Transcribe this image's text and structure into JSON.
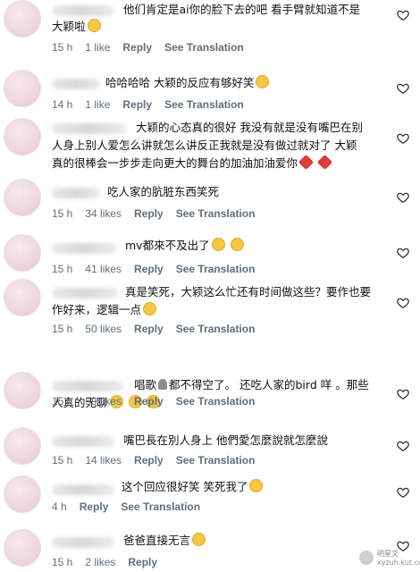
{
  "comments": [
    {
      "text_lines": [
        "他们肯定是ai你的脸下去的吧 看手臂就知道不是",
        "大颖啦"
      ],
      "emoji_tail": "😂",
      "time": "15 h",
      "likes": "1 like",
      "reply": "Reply",
      "translate": "See Translation"
    },
    {
      "text_lines": [
        "哈哈哈哈 大颖的反应有够好笑"
      ],
      "emoji_tail": "😂",
      "time": "14 h",
      "likes": "1 like",
      "reply": "Reply",
      "translate": "See Translation"
    },
    {
      "text_lines": [
        "大颖的心态真的很好 我没有就是没有嘴巴在别",
        "人身上别人爱怎么讲就怎么讲反正我就是没有做过就对了 大颖",
        "真的很棒会一步步走向更大的舞台的加油加油爱你"
      ],
      "emoji_tail": "❤️ ❤️",
      "time": "",
      "likes": "",
      "reply": "",
      "translate": ""
    },
    {
      "text_lines": [
        "吃人家的肮脏东西笑死"
      ],
      "emoji_tail": "",
      "time": "15 h",
      "likes": "34 likes",
      "reply": "Reply",
      "translate": "See Translation"
    },
    {
      "text_lines": [
        "mv都來不及出了"
      ],
      "emoji_tail": "😰 🤣",
      "time": "15 h",
      "likes": "41 likes",
      "reply": "Reply",
      "translate": "See Translation"
    },
    {
      "text_lines": [
        "真是笑死，大颖这么忙还有时间做这些？要作也要",
        "作好来，逻辑一点"
      ],
      "emoji_tail": "😂",
      "time": "15 h",
      "likes": "50 likes",
      "reply": "Reply",
      "translate": "See Translation"
    },
    {
      "text_lines": [
        "唱歌",
        "都不得空了。 还吃人家的bird 咩 。那些",
        "人真的无聊"
      ],
      "emoji_tail": "😂 😂 😂",
      "time": "15 h",
      "likes": "59 likes",
      "reply": "Reply",
      "translate": "See Translation"
    },
    {
      "text_lines": [
        "嘴巴長在別人身上 他們愛怎麼說就怎麼說"
      ],
      "emoji_tail": "",
      "time": "15 h",
      "likes": "14 likes",
      "reply": "Reply",
      "translate": "See Translation"
    },
    {
      "text_lines": [
        "这个回应很好笑 笑死我了"
      ],
      "emoji_tail": "🤣",
      "time": "4 h",
      "likes": "",
      "reply": "Reply",
      "translate": "See Translation"
    },
    {
      "text_lines": [
        "爸爸直接无言"
      ],
      "emoji_tail": "😂",
      "time": "15 h",
      "likes": "2 likes",
      "reply": "Reply",
      "translate": ""
    }
  ],
  "watermark": {
    "line1": "明星文",
    "line2": "xyzuh.kut.com"
  },
  "icons": {
    "like": "heart-outline-icon"
  }
}
